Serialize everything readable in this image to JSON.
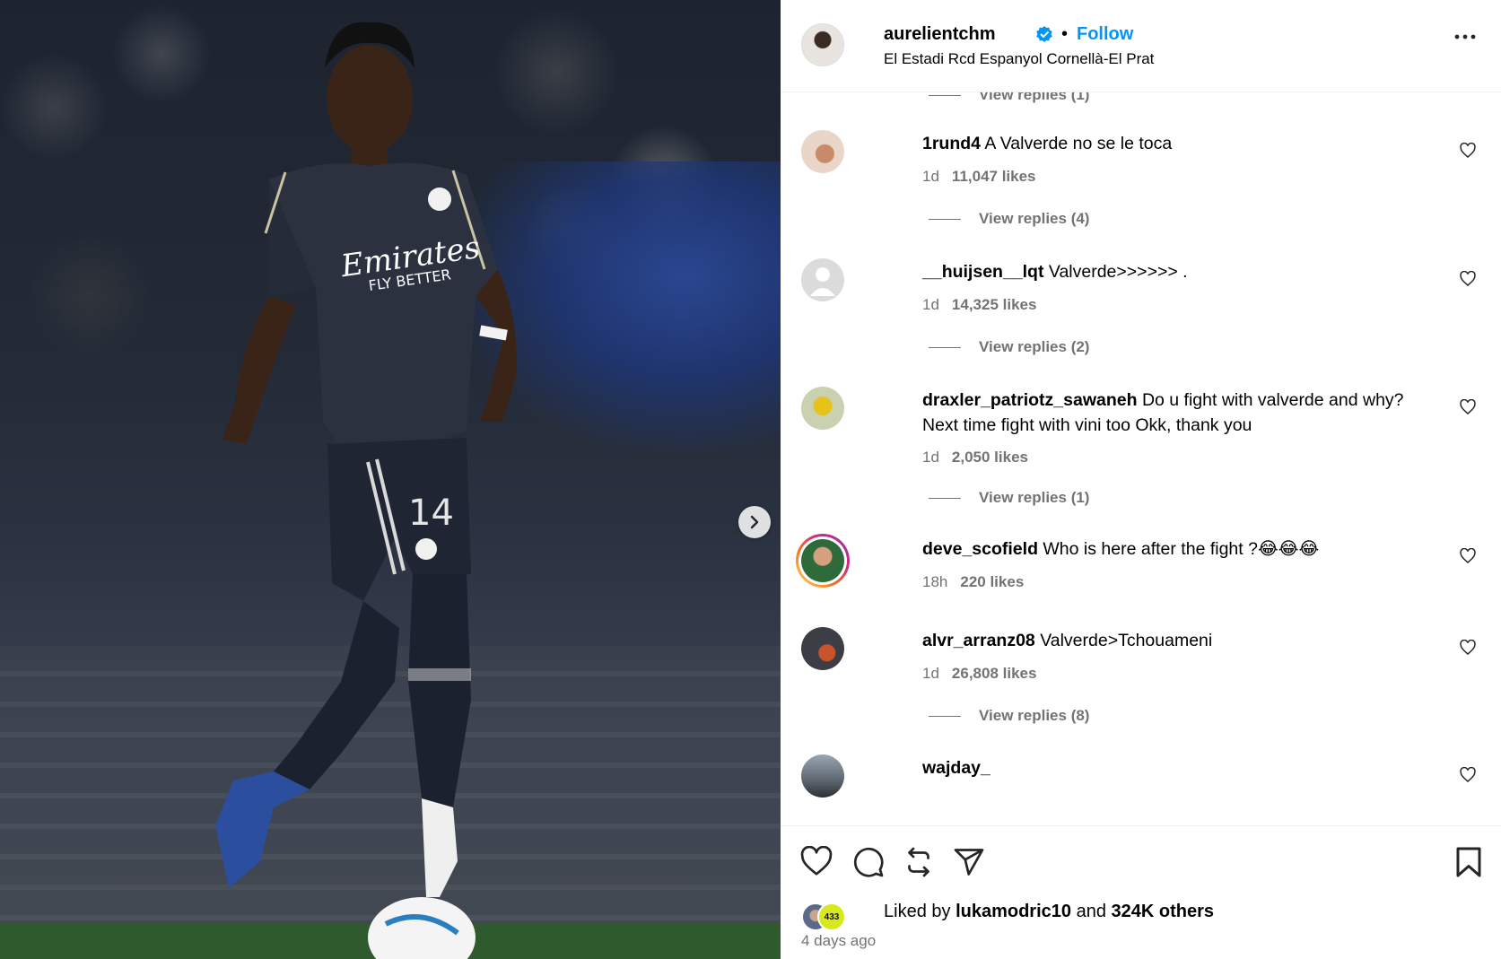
{
  "post": {
    "username": "aurelientchm",
    "location": "El Estadi Rcd Espanyol Cornellà-El Prat",
    "follow_label": "Follow",
    "separator": "•",
    "image_alt": "Player in dark kit with Emirates FLY BETTER shirt dribbling a ball"
  },
  "top_replies": "View replies (1)",
  "comments": [
    {
      "user": "1rund4",
      "text": "A Valverde no se le toca",
      "time": "1d",
      "likes": "11,047 likes",
      "replies": "View replies (4)"
    },
    {
      "user": "__huijsen__lqt",
      "text": "Valverde>>>>>> .",
      "time": "1d",
      "likes": "14,325 likes",
      "replies": "View replies (2)"
    },
    {
      "user": "draxler_patriotz_sawaneh",
      "text": "Do u fight with valverde and why? Next time fight with vini too Okk, thank you",
      "time": "1d",
      "likes": "2,050 likes",
      "replies": "View replies (1)"
    },
    {
      "user": "deve_scofield",
      "text": "Who is here after the fight ?😂😂😂",
      "time": "18h",
      "likes": "220 likes",
      "replies": ""
    },
    {
      "user": "alvr_arranz08",
      "text": "Valverde>Tchouameni",
      "time": "1d",
      "likes": "26,808 likes",
      "replies": "View replies (8)"
    },
    {
      "user": "wajday_",
      "text": "",
      "time": "",
      "likes": "",
      "replies": ""
    }
  ],
  "footer": {
    "liked_by_prefix": "Liked by",
    "liked_by_user": "lukamodric10",
    "liked_by_and": "and",
    "liked_by_others": "324K others",
    "time_ago": "4 days ago",
    "badge_text": "433"
  },
  "colors": {
    "accent": "#0095f6",
    "secondary_text": "#737373",
    "story_ring_start": "#feda75",
    "story_ring_end": "#d62976"
  },
  "icons": [
    "verified-icon",
    "more-icon",
    "heart-icon",
    "comment-icon",
    "repost-icon",
    "share-icon",
    "bookmark-icon",
    "chevron-right-icon"
  ]
}
